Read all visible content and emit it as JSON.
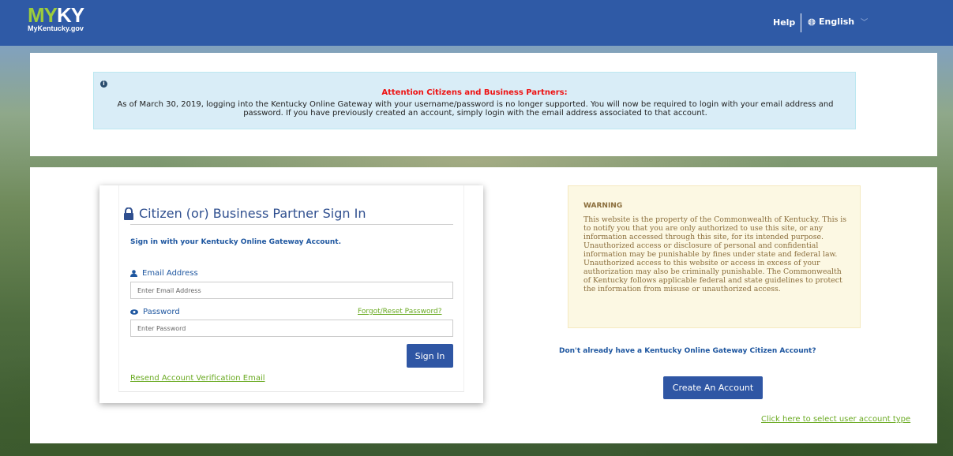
{
  "header": {
    "logo_main_prefix": "MY",
    "logo_main_suffix": "KY",
    "logo_sub": "MyKentucky.gov",
    "help": "Help",
    "language": "English"
  },
  "alert": {
    "title": "Attention Citizens and Business Partners:",
    "text": "As of March 30, 2019, logging into the Kentucky Online Gateway with your username/password is no longer supported. You will now be required to login with your email address and password. If you have previously created an account, simply login with the email address associated to that account."
  },
  "signin": {
    "title": "Citizen (or) Business Partner Sign In",
    "subtitle": "Sign in with your Kentucky Online Gateway Account.",
    "email_label": "Email Address",
    "email_placeholder": "Enter Email Address",
    "password_label": "Password",
    "password_placeholder": "Enter Password",
    "forgot": "Forgot/Reset Password?",
    "button": "Sign In",
    "resend": "Resend Account Verification Email"
  },
  "warning": {
    "title": "WARNING",
    "text": "This website is the property of the Commonwealth of Kentucky. This is to notify you that you are only authorized to use this site, or any information accessed through this site, for its intended purpose. Unauthorized access or disclosure of personal and confidential information may be punishable by fines under state and federal law. Unauthorized access to this website or access in excess of your authorization may also be criminally punishable. The Commonwealth of Kentucky follows applicable federal and state guidelines to protect the information from misuse or unauthorized access."
  },
  "account": {
    "prompt": "Don't already have a Kentucky Online Gateway Citizen Account?",
    "create": "Create An Account",
    "select_type": "Click here to select user account type"
  },
  "colors": {
    "header_bg": "#2f5aa6",
    "button_bg": "#2f56a4",
    "link_green": "#6aaa22",
    "alert_red": "#ee1111"
  }
}
